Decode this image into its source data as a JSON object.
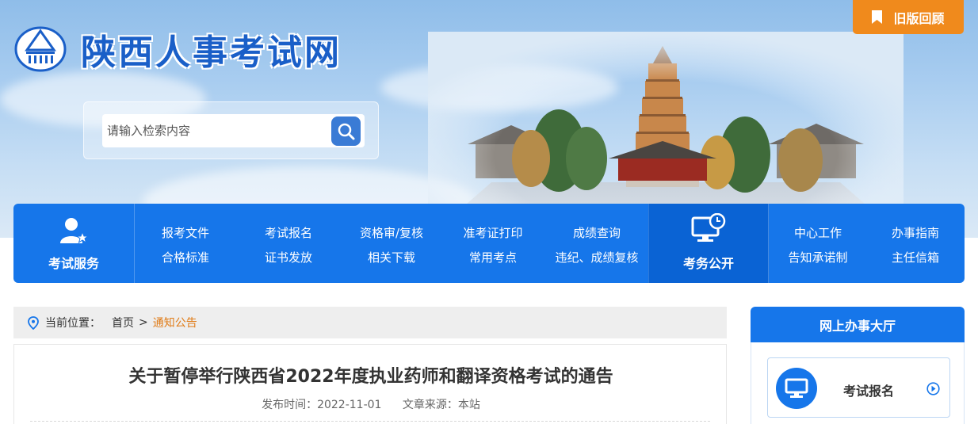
{
  "site": {
    "title": "陕西人事考试网",
    "old_version_label": "旧版回顾",
    "icons": {
      "emblem": "site-emblem-icon",
      "old_version": "bookmark-icon"
    }
  },
  "search": {
    "placeholder": "请输入检索内容",
    "value": "",
    "icon": "search-icon"
  },
  "nav": {
    "service": {
      "label": "考试服务",
      "icon": "user-star-icon"
    },
    "links": [
      {
        "label": "报考文件"
      },
      {
        "label": "考试报名"
      },
      {
        "label": "资格审/复核"
      },
      {
        "label": "准考证打印"
      },
      {
        "label": "成绩查询"
      },
      {
        "label": "合格标准"
      },
      {
        "label": "证书发放"
      },
      {
        "label": "相关下载"
      },
      {
        "label": "常用考点"
      },
      {
        "label": "违纪、成绩复核"
      }
    ],
    "open": {
      "label": "考务公开",
      "icon": "monitor-clock-icon"
    },
    "right_links": [
      {
        "label": "中心工作"
      },
      {
        "label": "办事指南"
      },
      {
        "label": "告知承诺制"
      },
      {
        "label": "主任信箱"
      }
    ]
  },
  "breadcrumb": {
    "prefix": "当前位置：",
    "home": "首页",
    "separator": ">",
    "current": "通知公告",
    "icon": "location-pin-icon"
  },
  "article": {
    "title": "关于暂停举行陕西省2022年度执业药师和翻译资格考试的通告",
    "publish_label": "发布时间：2022-11-01",
    "source_label": "文章来源：本站"
  },
  "sidebar": {
    "hall_title": "网上办事大厅",
    "cards": [
      {
        "label": "考试报名",
        "icon": "monitor-icon",
        "arrow_icon": "circle-arrow-right-icon"
      }
    ]
  },
  "colors": {
    "primary": "#1676ea",
    "primary_dark": "#0a63d4",
    "accent_orange": "#f08a1c",
    "breadcrumb_current": "#e07b16"
  }
}
